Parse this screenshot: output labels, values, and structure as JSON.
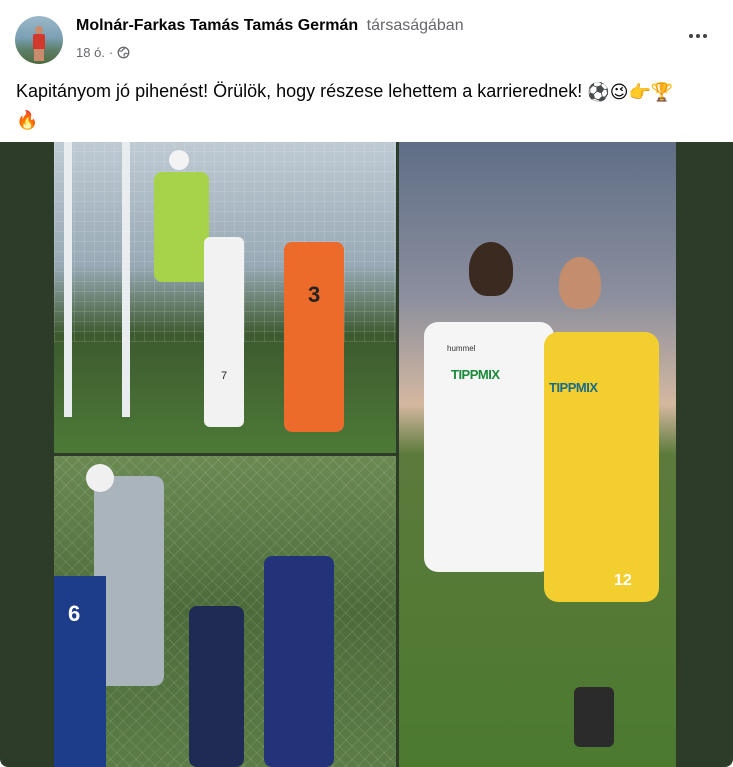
{
  "post": {
    "author": "Molnár-Farkas Tamás Tamás Germán",
    "with_text": "társaságában",
    "time": "18 ó.",
    "separator": "·",
    "privacy_icon": "globe-icon",
    "text_main": "Kapitányom jó pihenést! Örülök, hogy részese lehettem a karrierednek!",
    "emoji_line1": "⚽😉👉🏆",
    "emoji_line2": "🔥",
    "more_icon": "more-options-icon"
  },
  "photos": {
    "p1": {
      "jersey_number": "3",
      "jersey_number_2": "7"
    },
    "p2": {
      "jersey_number": "6"
    },
    "p3": {
      "sponsor": "TIPPMIX",
      "sponsor_2": "TIPPMIX",
      "brand": "hummel",
      "number": "12"
    }
  },
  "colors": {
    "background_media": "#2d3c29",
    "muted_text": "#65676b"
  }
}
